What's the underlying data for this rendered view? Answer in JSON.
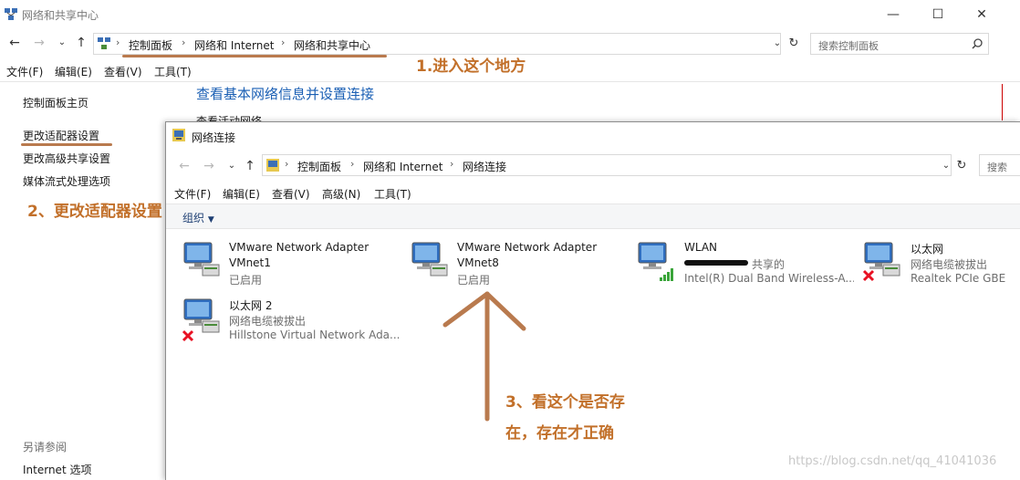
{
  "outer": {
    "title": "网络和共享中心",
    "breadcrumbs": [
      "控制面板",
      "网络和 Internet",
      "网络和共享中心"
    ],
    "search_placeholder": "搜索控制面板",
    "menu": [
      "文件(F)",
      "编辑(E)",
      "查看(V)",
      "工具(T)"
    ],
    "sidebar": {
      "home": "控制面板主页",
      "items": [
        "更改适配器设置",
        "更改高级共享设置",
        "媒体流式处理选项"
      ],
      "see_also_title": "另请参阅",
      "see_also_items": [
        "Internet 选项"
      ]
    },
    "main_heading": "查看基本网络信息并设置连接",
    "sub_heading": "查看活动网络"
  },
  "inner": {
    "title": "网络连接",
    "breadcrumbs": [
      "控制面板",
      "网络和 Internet",
      "网络连接"
    ],
    "search_placeholder": "搜索",
    "menu": [
      "文件(F)",
      "编辑(E)",
      "查看(V)",
      "高级(N)",
      "工具(T)"
    ],
    "organize_label": "组织",
    "adapters": [
      {
        "name": "VMware Network Adapter",
        "line2": "VMnet1",
        "line3": "已启用",
        "status": "enabled"
      },
      {
        "name": "VMware Network Adapter",
        "line2": "VMnet8",
        "line3": "已启用",
        "status": "enabled"
      },
      {
        "name": "WLAN",
        "line2": "共享的",
        "line3": "Intel(R) Dual Band Wireless-A...",
        "status": "wifi"
      },
      {
        "name": "以太网",
        "line2": "网络电缆被拔出",
        "line3": "Realtek PCIe GBE",
        "status": "disconnected"
      },
      {
        "name": "以太网 2",
        "line2": "网络电缆被拔出",
        "line3": "Hillstone Virtual Network Ada...",
        "status": "disconnected"
      }
    ]
  },
  "annotations": {
    "step1": "1.进入这个地方",
    "step2": "2、更改适配器设置",
    "step3_line1": "3、看这个是否存",
    "step3_line2": "在，存在才正确"
  },
  "watermark": "https://blog.csdn.net/qq_41041036",
  "colors": {
    "annotation": "#c2702a",
    "annotation_line": "#b97a4e",
    "link_blue": "#1a5fb4",
    "error_red": "#e81123"
  },
  "icons": [
    "network-center-icon",
    "network-connections-icon",
    "back-arrow-icon",
    "forward-arrow-icon",
    "up-arrow-icon",
    "refresh-icon",
    "search-icon",
    "monitor-network-icon",
    "red-x-icon",
    "wifi-signal-icon"
  ]
}
